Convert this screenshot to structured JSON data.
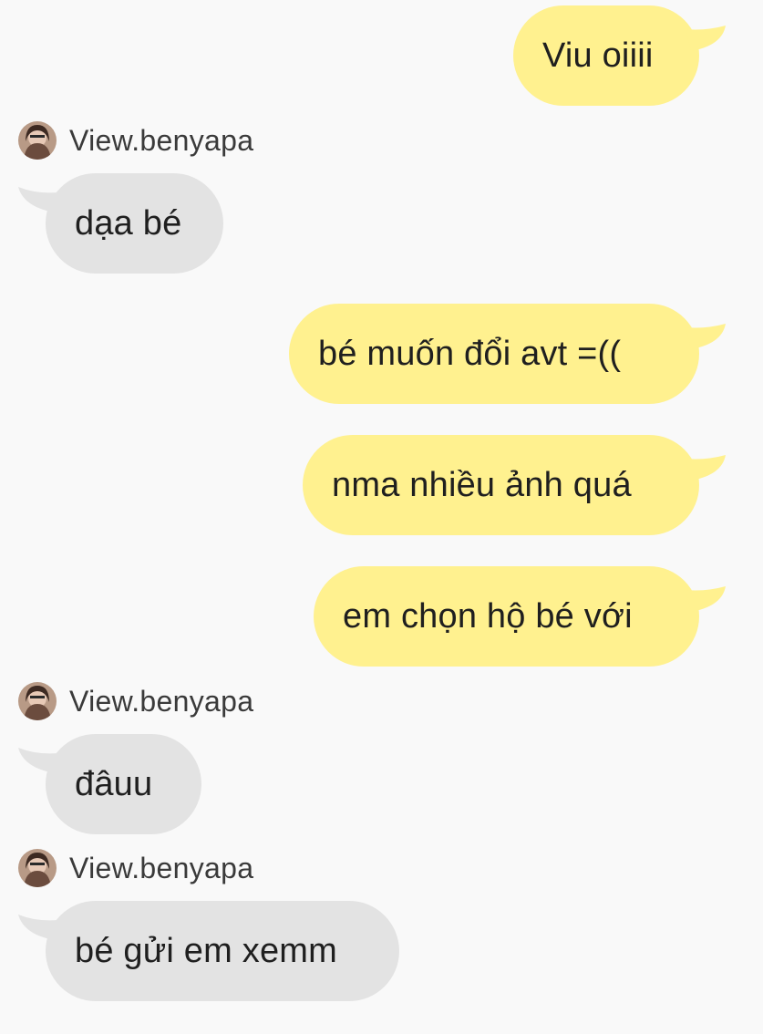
{
  "contact": {
    "name": "View.benyapa",
    "avatar_icon": "profile-photo-avatar"
  },
  "colors": {
    "background": "#f9f9f9",
    "outgoing_bubble": "#fff18f",
    "incoming_bubble": "#e3e3e3",
    "text": "#1f1f1f"
  },
  "messages": [
    {
      "direction": "outgoing",
      "text": "Viu oiiii"
    },
    {
      "direction": "incoming",
      "sender": "View.benyapa",
      "text": "dạa bé"
    },
    {
      "direction": "outgoing",
      "text": "bé muốn đổi avt =(("
    },
    {
      "direction": "outgoing",
      "text": "nma nhiều ảnh quá"
    },
    {
      "direction": "outgoing",
      "text": "em chọn hộ bé với"
    },
    {
      "direction": "incoming",
      "sender": "View.benyapa",
      "text": "đâuu"
    },
    {
      "direction": "incoming",
      "sender": "View.benyapa",
      "text": "bé gửi em xemm"
    }
  ]
}
